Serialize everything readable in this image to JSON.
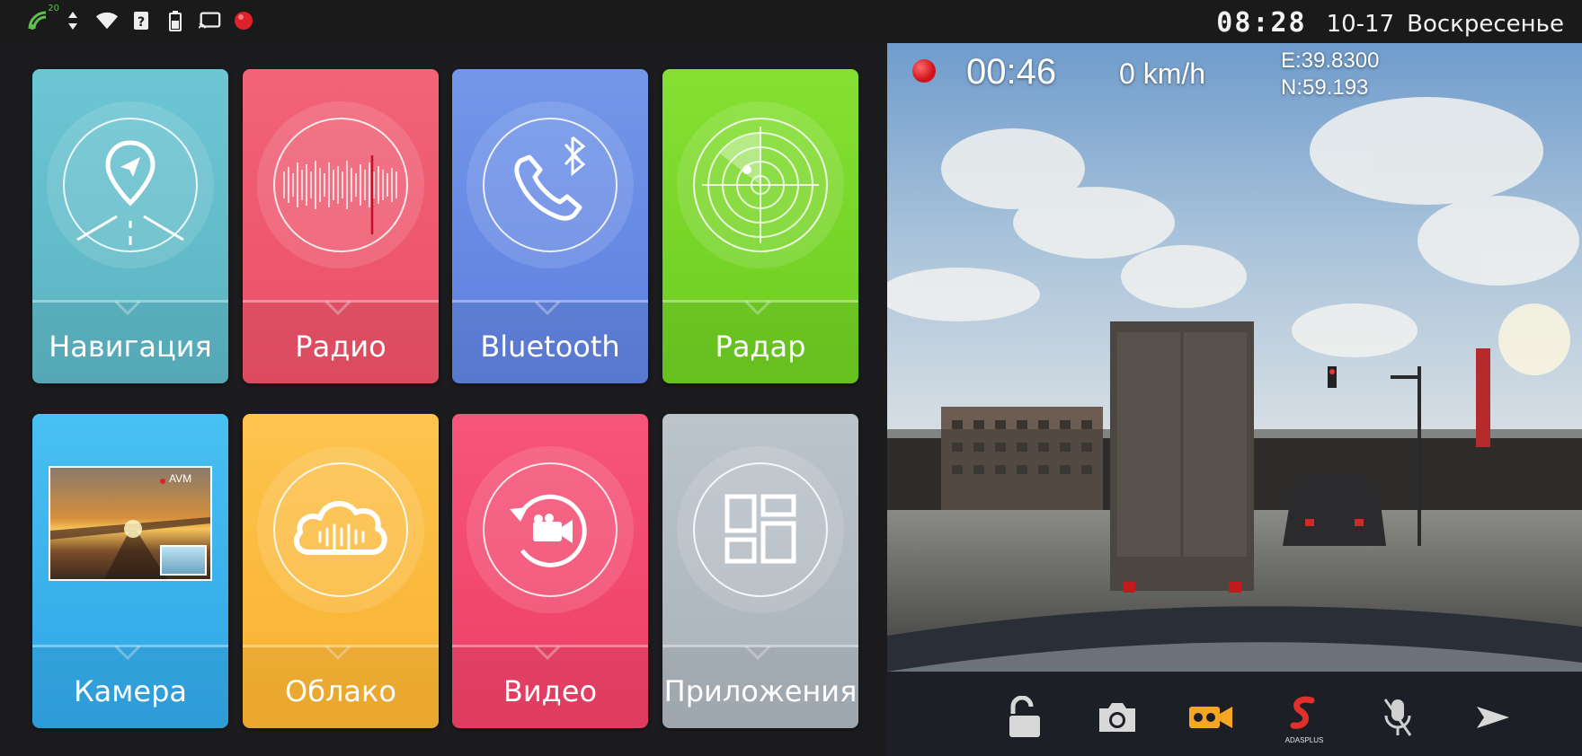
{
  "status_bar": {
    "network_label": "20",
    "time": "08:28",
    "date": "10-17",
    "weekday": "Воскресенье",
    "icons": [
      "wifi-signal-icon",
      "data-arrows-icon",
      "wifi-icon",
      "sim-question-icon",
      "battery-icon",
      "cast-icon",
      "record-indicator-icon"
    ]
  },
  "tiles": [
    {
      "id": "navigation",
      "label": "Навигация",
      "icon": "location-pin-icon",
      "color": "#67c1cf"
    },
    {
      "id": "radio",
      "label": "Радио",
      "icon": "radio-waveform-icon",
      "color": "#ef5a6f"
    },
    {
      "id": "bluetooth",
      "label": "Bluetooth",
      "icon": "phone-bluetooth-icon",
      "color": "#6c8ee6"
    },
    {
      "id": "radar",
      "label": "Радар",
      "icon": "radar-icon",
      "color": "#7bd82a"
    },
    {
      "id": "camera",
      "label": "Камера",
      "icon": "camera-preview",
      "color": "#3fb1ec",
      "preview_badge": "AVM"
    },
    {
      "id": "cloud",
      "label": "Облако",
      "icon": "cloud-voice-icon",
      "color": "#fbbb3f"
    },
    {
      "id": "video",
      "label": "Видео",
      "icon": "video-replay-icon",
      "color": "#f3496f"
    },
    {
      "id": "apps",
      "label": "Приложения",
      "icon": "apps-grid-icon",
      "color": "#b3bcc3"
    }
  ],
  "dashcam": {
    "rec_time": "00:46",
    "speed": "0 km/h",
    "gps_e": "E:39.8300",
    "gps_n": "N:59.193",
    "toolbar": [
      {
        "id": "lock",
        "icon": "unlock-icon"
      },
      {
        "id": "snapshot",
        "icon": "camera-icon"
      },
      {
        "id": "record",
        "icon": "video-record-icon",
        "active_color": "#f5a623"
      },
      {
        "id": "adas",
        "icon": "adas-logo-icon",
        "text": "ADASPLUS"
      },
      {
        "id": "mic",
        "icon": "mic-muted-icon"
      },
      {
        "id": "next",
        "icon": "play-arrow-icon"
      }
    ]
  }
}
